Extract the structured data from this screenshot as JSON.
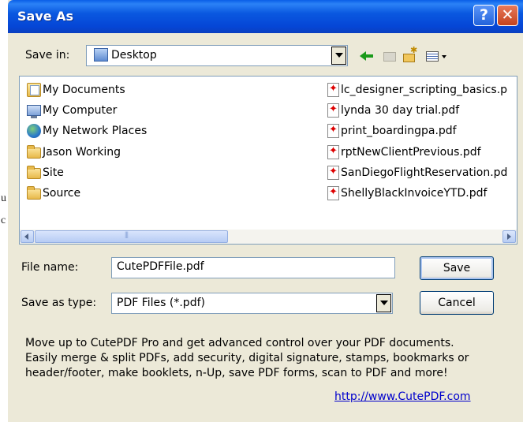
{
  "background": {
    "fragments": [
      "u",
      "c"
    ]
  },
  "dialog": {
    "title": "Save As",
    "help_label": "?",
    "close_label": "✕",
    "save_in_label": "Save in:",
    "save_in_value": "Desktop",
    "toolbar": {
      "icons": [
        "back-arrow-icon",
        "up-folder-icon",
        "new-folder-icon",
        "views-menu-icon"
      ]
    },
    "left_items": [
      {
        "label": "My Documents",
        "icon": "my-documents-icon"
      },
      {
        "label": "My Computer",
        "icon": "my-computer-icon"
      },
      {
        "label": "My Network Places",
        "icon": "network-places-icon"
      },
      {
        "label": "Jason Working",
        "icon": "folder-icon"
      },
      {
        "label": "Site",
        "icon": "folder-icon"
      },
      {
        "label": "Source",
        "icon": "folder-icon"
      }
    ],
    "right_items": [
      {
        "label": "lc_designer_scripting_basics.p",
        "icon": "pdf-icon"
      },
      {
        "label": "lynda 30 day trial.pdf",
        "icon": "pdf-icon"
      },
      {
        "label": "print_boardingpa.pdf",
        "icon": "pdf-icon"
      },
      {
        "label": "rptNewClientPrevious.pdf",
        "icon": "pdf-icon"
      },
      {
        "label": "SanDiegoFlightReservation.pd",
        "icon": "pdf-icon"
      },
      {
        "label": "ShellyBlackInvoiceYTD.pdf",
        "icon": "pdf-icon"
      }
    ],
    "file_name_label": "File name:",
    "file_name_value": "CutePDFFile.pdf",
    "save_as_type_label": "Save as type:",
    "save_as_type_value": "PDF Files (*.pdf)",
    "save_button": "Save",
    "cancel_button": "Cancel",
    "promo_lines": [
      "Move up to CutePDF Pro and get advanced control over your PDF documents.",
      "Easily merge & split PDFs, add security, digital signature, stamps, bookmarks or",
      "header/footer, make booklets, n-Up, save PDF forms, scan to PDF and more!"
    ],
    "link": "http://www.CutePDF.com",
    "colors": {
      "titlebar": "#0a58e0",
      "dialog_bg": "#ece9d8",
      "link": "#0000cc"
    }
  }
}
